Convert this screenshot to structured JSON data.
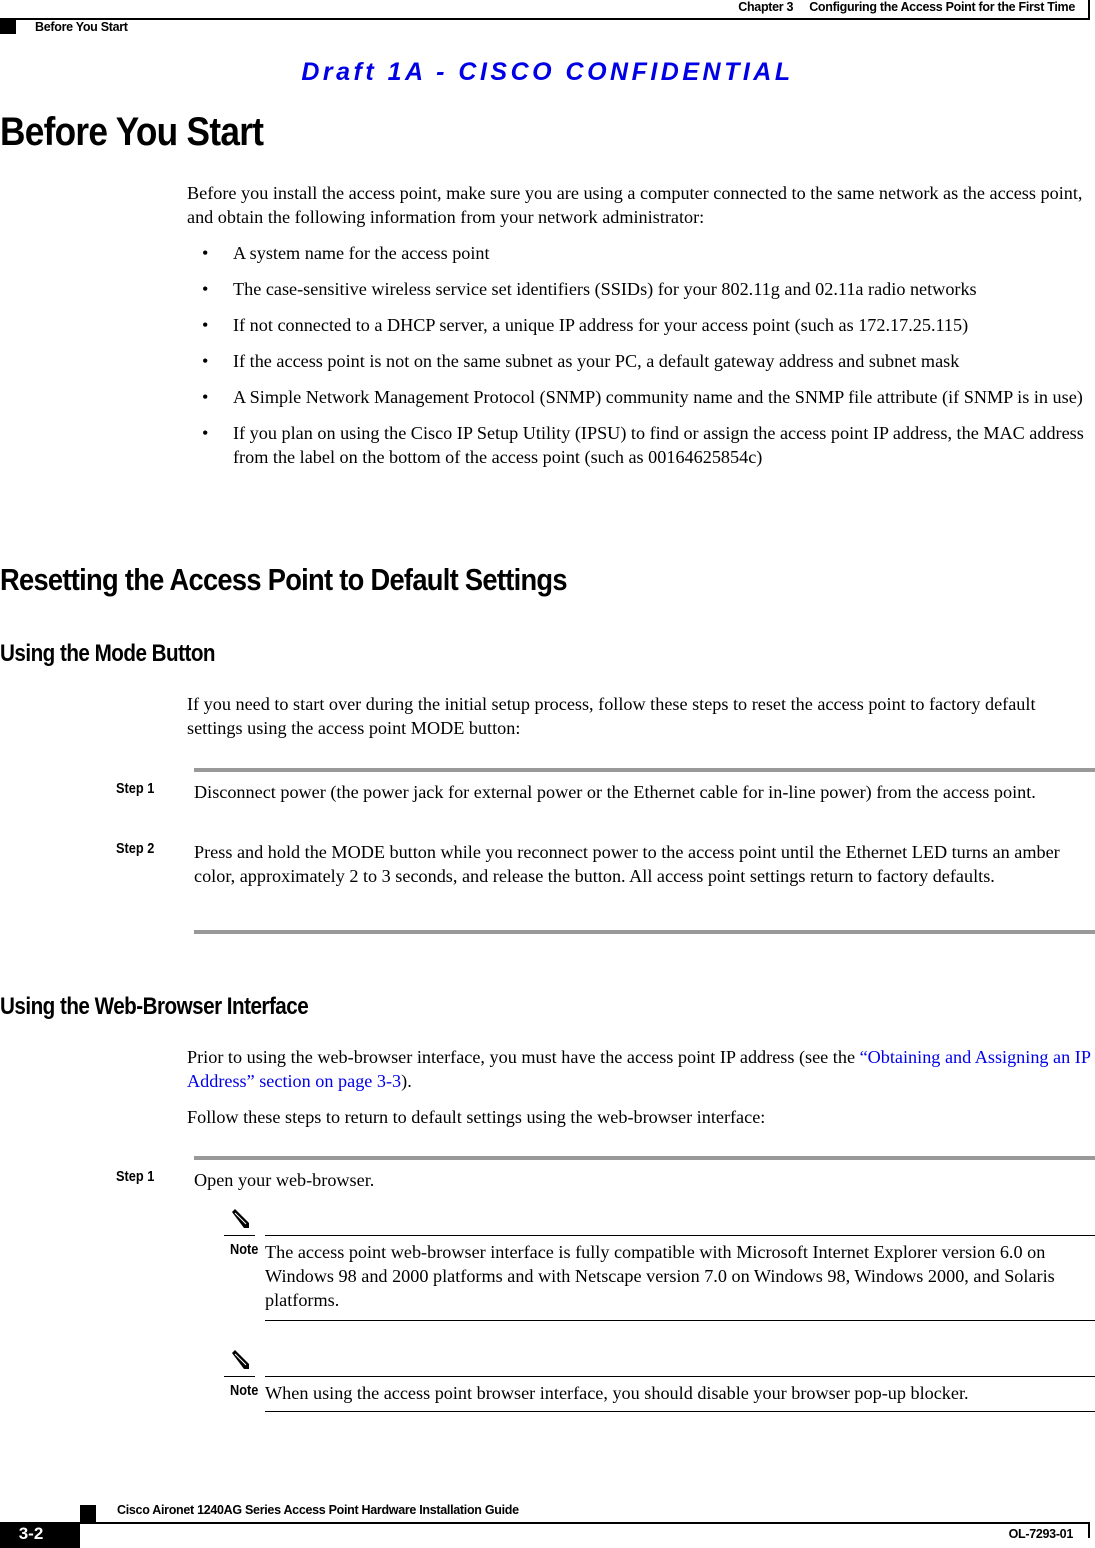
{
  "header": {
    "chapter_label": "Chapter 3",
    "chapter_title": "Configuring the Access Point for the First Time",
    "section": "Before You Start"
  },
  "watermark": "Draft 1A - CISCO CONFIDENTIAL",
  "sections": {
    "before_you_start": {
      "title": "Before You Start",
      "intro": "Before you install the access point, make sure you are using a computer connected to the same network as the access point, and obtain the following information from your network administrator:",
      "bullets": [
        "A system name for the access point",
        "The case-sensitive wireless service set identifiers (SSIDs) for your 802.11g and 02.11a radio networks",
        "If not connected to a DHCP server, a unique IP address for your access point (such as 172.17.25.115)",
        "If the access point is not on the same subnet as your PC, a default gateway address and subnet mask",
        "A Simple Network Management Protocol (SNMP) community name and the SNMP file attribute (if SNMP is in use)",
        "If you plan on using the Cisco IP Setup Utility (IPSU) to find or assign the access point IP address, the MAC address from the label on the bottom of the access point (such as 00164625854c)"
      ]
    },
    "resetting": {
      "title": "Resetting the Access Point to Default Settings",
      "mode_button": {
        "title": "Using the Mode Button",
        "intro": "If you need to start over during the initial setup process, follow these steps to reset the access point to factory default settings using the access point MODE button:",
        "steps": [
          {
            "label": "Step 1",
            "text": "Disconnect power (the power jack for external power or the Ethernet cable for in-line power) from the access point."
          },
          {
            "label": "Step 2",
            "text": "Press and hold the MODE button while you reconnect power to the access point until the Ethernet LED turns an amber color, approximately 2 to 3 seconds, and release the button. All access point settings return to factory defaults."
          }
        ]
      },
      "web_browser": {
        "title": "Using the Web-Browser Interface",
        "intro_before_link": "Prior to using the web-browser interface, you must have the access point IP address (see the ",
        "link_text": "“Obtaining and Assigning an IP Address” section on page 3-3",
        "intro_after_link": ").",
        "follow": "Follow these steps to return to default settings using the web-browser interface:",
        "steps": [
          {
            "label": "Step 1",
            "text": "Open your web-browser."
          }
        ],
        "notes": [
          {
            "label": "Note",
            "icon": "pencil-note-icon",
            "text": "The access point web-browser interface is fully compatible with Microsoft Internet Explorer version 6.0 on Windows 98 and 2000 platforms and with Netscape version 7.0 on Windows 98, Windows 2000, and Solaris platforms."
          },
          {
            "label": "Note",
            "icon": "pencil-note-icon",
            "text": "When using the access point browser interface, you should disable your browser pop-up blocker."
          }
        ]
      }
    }
  },
  "footer": {
    "guide_title": "Cisco Aironet 1240AG Series Access Point Hardware Installation Guide",
    "page_number": "3-2",
    "doc_number": "OL-7293-01"
  },
  "colors": {
    "link": "#0000e6",
    "watermark": "#0000e6",
    "step_rule": "#999999"
  }
}
